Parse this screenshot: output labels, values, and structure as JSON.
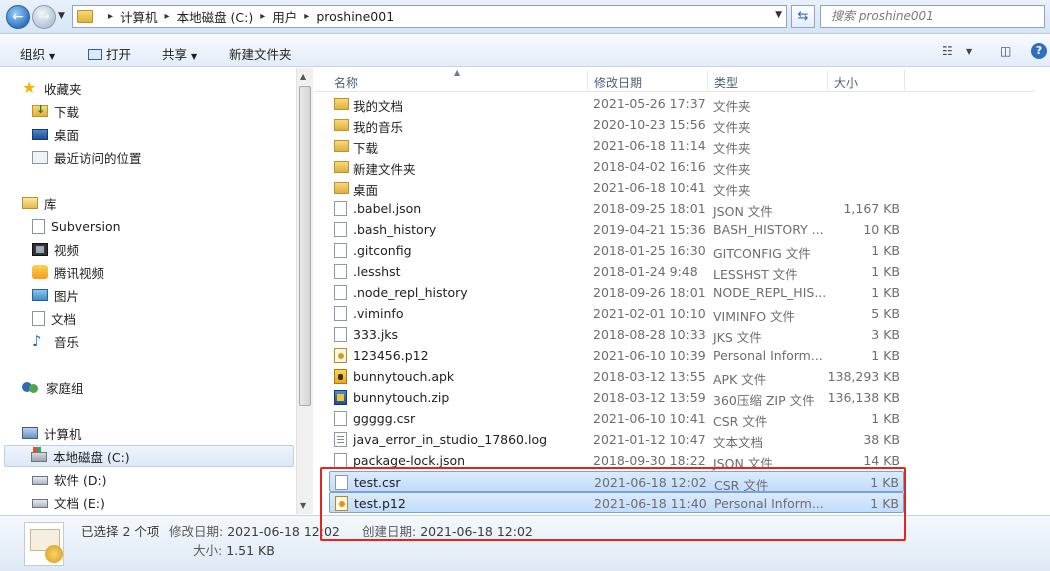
{
  "address": {
    "crumbs": [
      "计算机",
      "本地磁盘 (C:)",
      "用户",
      "proshine001"
    ],
    "search_placeholder": "搜索 proshine001"
  },
  "toolbar": {
    "organize": "组织",
    "open": "打开",
    "share": "共享",
    "new_folder": "新建文件夹"
  },
  "nav": {
    "favorites": "收藏夹",
    "downloads": "下载",
    "desktop": "桌面",
    "recent": "最近访问的位置",
    "libraries": "库",
    "subversion": "Subversion",
    "videos": "视频",
    "tencent_video": "腾讯视频",
    "pictures": "图片",
    "documents": "文档",
    "music": "音乐",
    "homegroup": "家庭组",
    "computer": "计算机",
    "drive_c": "本地磁盘 (C:)",
    "drive_d": "软件 (D:)",
    "drive_e": "文档 (E:)"
  },
  "columns": {
    "name": "名称",
    "date": "修改日期",
    "type": "类型",
    "size": "大小"
  },
  "files": [
    {
      "name": "我的文档",
      "date": "2021-05-26 17:37",
      "type": "文件夹",
      "size": "",
      "icon": "folder"
    },
    {
      "name": "我的音乐",
      "date": "2020-10-23 15:56",
      "type": "文件夹",
      "size": "",
      "icon": "folder"
    },
    {
      "name": "下载",
      "date": "2021-06-18 11:14",
      "type": "文件夹",
      "size": "",
      "icon": "folder"
    },
    {
      "name": "新建文件夹",
      "date": "2018-04-02 16:16",
      "type": "文件夹",
      "size": "",
      "icon": "folder"
    },
    {
      "name": "桌面",
      "date": "2021-06-18 10:41",
      "type": "文件夹",
      "size": "",
      "icon": "folder"
    },
    {
      "name": ".babel.json",
      "date": "2018-09-25 18:01",
      "type": "JSON 文件",
      "size": "1,167 KB",
      "icon": "doc"
    },
    {
      "name": ".bash_history",
      "date": "2019-04-21 15:36",
      "type": "BASH_HISTORY ...",
      "size": "10 KB",
      "icon": "doc"
    },
    {
      "name": ".gitconfig",
      "date": "2018-01-25 16:30",
      "type": "GITCONFIG 文件",
      "size": "1 KB",
      "icon": "doc"
    },
    {
      "name": ".lesshst",
      "date": "2018-01-24 9:48",
      "type": "LESSHST 文件",
      "size": "1 KB",
      "icon": "doc"
    },
    {
      "name": ".node_repl_history",
      "date": "2018-09-26 18:01",
      "type": "NODE_REPL_HIS...",
      "size": "1 KB",
      "icon": "doc"
    },
    {
      "name": ".viminfo",
      "date": "2021-02-01 10:10",
      "type": "VIMINFO 文件",
      "size": "5 KB",
      "icon": "doc"
    },
    {
      "name": "333.jks",
      "date": "2018-08-28 10:33",
      "type": "JKS 文件",
      "size": "3 KB",
      "icon": "doc"
    },
    {
      "name": "123456.p12",
      "date": "2021-06-10 10:39",
      "type": "Personal Inform...",
      "size": "1 KB",
      "icon": "cert"
    },
    {
      "name": "bunnytouch.apk",
      "date": "2018-03-12 13:55",
      "type": "APK 文件",
      "size": "138,293 KB",
      "icon": "apk"
    },
    {
      "name": "bunnytouch.zip",
      "date": "2018-03-12 13:59",
      "type": "360压缩 ZIP 文件",
      "size": "136,138 KB",
      "icon": "zip"
    },
    {
      "name": "ggggg.csr",
      "date": "2021-06-10 10:41",
      "type": "CSR 文件",
      "size": "1 KB",
      "icon": "doc"
    },
    {
      "name": "java_error_in_studio_17860.log",
      "date": "2021-01-12 10:47",
      "type": "文本文档",
      "size": "38 KB",
      "icon": "txt"
    },
    {
      "name": "package-lock.json",
      "date": "2018-09-30 18:22",
      "type": "JSON 文件",
      "size": "14 KB",
      "icon": "doc"
    },
    {
      "name": "test.csr",
      "date": "2021-06-18 12:02",
      "type": "CSR 文件",
      "size": "1 KB",
      "icon": "doc",
      "selected": true
    },
    {
      "name": "test.p12",
      "date": "2021-06-18 11:40",
      "type": "Personal Inform...",
      "size": "1 KB",
      "icon": "cert",
      "selected": true
    }
  ],
  "status": {
    "selected": "已选择 2 个项",
    "modified_label": "修改日期:",
    "modified_value": "2021-06-18 12:02",
    "created_label": "创建日期:",
    "created_value": "2021-06-18 12:02",
    "size_label": "大小:",
    "size_value": "1.51 KB"
  }
}
